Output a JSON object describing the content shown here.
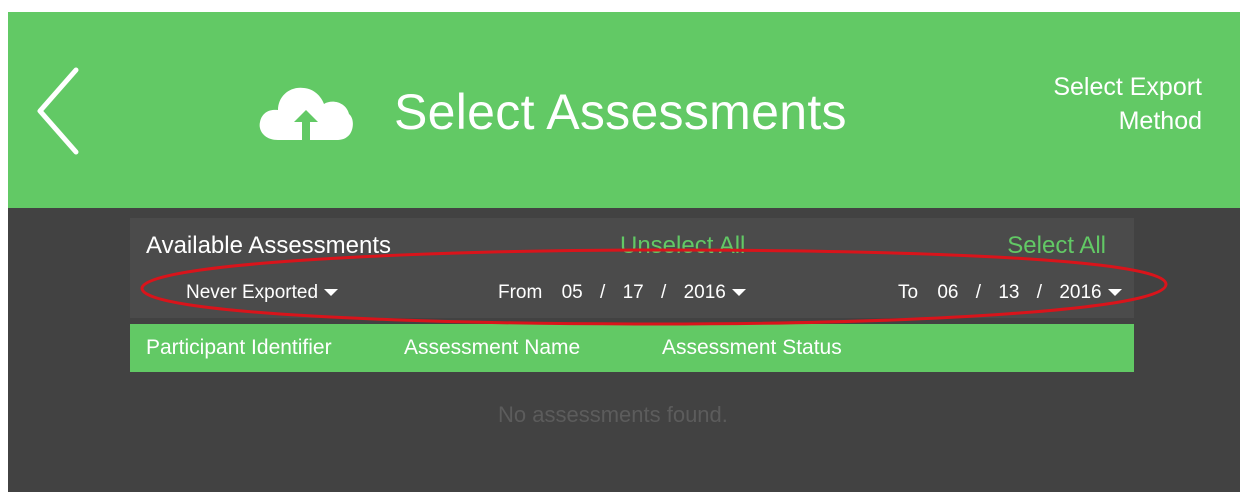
{
  "header": {
    "back_icon": "chevron-left-icon",
    "cloud_icon": "cloud-upload-icon",
    "title": "Select Assessments",
    "export_method_line1": "Select Export",
    "export_method_line2": "Method"
  },
  "panel": {
    "available_label": "Available Assessments",
    "unselect_all": "Unselect All",
    "select_all": "Select All"
  },
  "filter": {
    "status": "Never Exported",
    "from_label": "From",
    "from_month": "05",
    "from_day": "17",
    "from_year": "2016",
    "to_label": "To",
    "to_month": "06",
    "to_day": "13",
    "to_year": "2016",
    "separator": "/"
  },
  "table": {
    "columns": [
      "Participant Identifier",
      "Assessment Name",
      "Assessment Status"
    ],
    "empty_message": "No assessments found."
  },
  "colors": {
    "accent_green": "#62c965",
    "background_dark": "#424242",
    "annotation_red": "#d9141b"
  }
}
